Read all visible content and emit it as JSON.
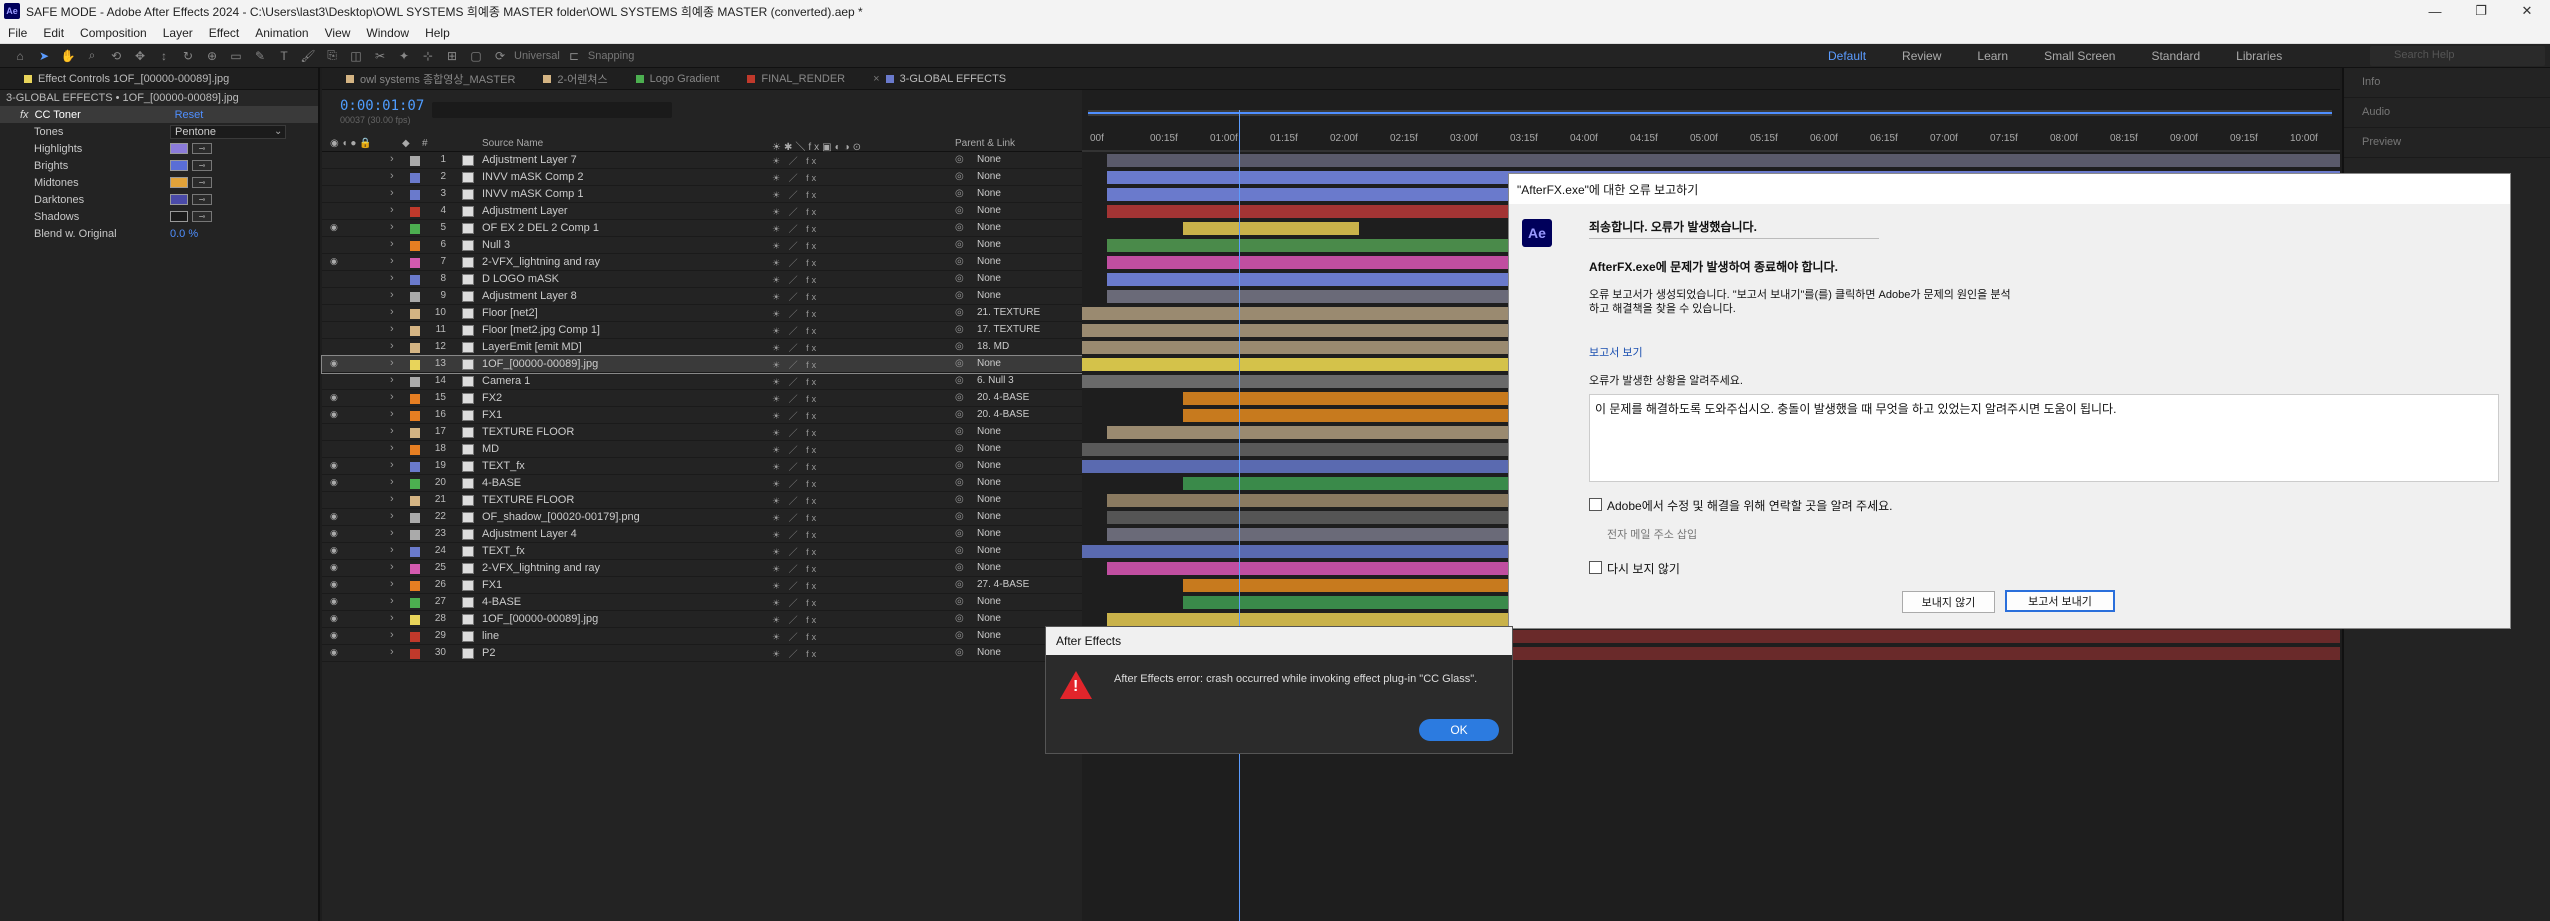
{
  "window": {
    "title": "SAFE MODE - Adobe After Effects 2024 - C:\\Users\\last3\\Desktop\\OWL SYSTEMS 희예종 MASTER folder\\OWL SYSTEMS 희예종 MASTER (converted).aep *",
    "logo": "Ae"
  },
  "menu": [
    "File",
    "Edit",
    "Composition",
    "Layer",
    "Effect",
    "Animation",
    "View",
    "Window",
    "Help"
  ],
  "toolbar": {
    "universal": "Universal",
    "snapping": "Snapping",
    "workspaces": [
      "Default",
      "Review",
      "Learn",
      "Small Screen",
      "Standard",
      "Libraries"
    ],
    "active_workspace": "Default",
    "search_placeholder": "Search Help"
  },
  "effect_controls": {
    "tab": "Effect Controls 1OF_[00000-00089].jpg",
    "subtitle": "3-GLOBAL EFFECTS • 1OF_[00000-00089].jpg",
    "effect_name": "CC Toner",
    "reset": "Reset",
    "props": [
      {
        "label": "Tones",
        "type": "dropdown",
        "value": "Pentone"
      },
      {
        "label": "Highlights",
        "type": "color",
        "color": "#8b7bd9"
      },
      {
        "label": "Brights",
        "type": "color",
        "color": "#5a6ed6"
      },
      {
        "label": "Midtones",
        "type": "color",
        "color": "#e0a23a"
      },
      {
        "label": "Darktones",
        "type": "color",
        "color": "#4a4aa8"
      },
      {
        "label": "Shadows",
        "type": "color",
        "color": "#1a1a1a"
      },
      {
        "label": "Blend w. Original",
        "type": "value",
        "value": "0.0 %"
      }
    ]
  },
  "comp_tabs": [
    "owl systems 종합영상_MASTER",
    "2-어렌쳐스",
    "Logo Gradient",
    "FINAL_RENDER",
    "3-GLOBAL EFFECTS"
  ],
  "timeline": {
    "timecode": "0:00:01:07",
    "fps": "00037 (30.00 fps)",
    "col_source": "Source Name",
    "col_parent": "Parent & Link",
    "ruler": [
      "00f",
      "00:15f",
      "01:00f",
      "01:15f",
      "02:00f",
      "02:15f",
      "03:00f",
      "03:15f",
      "04:00f",
      "04:15f",
      "05:00f",
      "05:15f",
      "06:00f",
      "06:15f",
      "07:00f",
      "07:15f",
      "08:00f",
      "08:15f",
      "09:00f",
      "09:15f",
      "10:00f"
    ],
    "layers": [
      {
        "n": "1",
        "name": "Adjustment Layer 7",
        "color": "#aaaaaa",
        "parent": "None",
        "eye": false,
        "bar": "#5a5a6a",
        "bs": 0.02,
        "be": 1.0
      },
      {
        "n": "2",
        "name": "INVV mASK Comp 2",
        "color": "#6a7acc",
        "parent": "None",
        "eye": false,
        "bar": "#6a7acc",
        "bs": 0.02,
        "be": 1.0
      },
      {
        "n": "3",
        "name": "INVV mASK Comp 1",
        "color": "#6a7acc",
        "parent": "None",
        "eye": false,
        "bar": "#6a7acc",
        "bs": 0.02,
        "be": 1.0
      },
      {
        "n": "4",
        "name": "Adjustment Layer",
        "color": "#c0392b",
        "parent": "None",
        "eye": false,
        "bar": "#a33434",
        "bs": 0.02,
        "be": 1.0
      },
      {
        "n": "5",
        "name": "OF EX 2 DEL 2 Comp 1",
        "color": "#4caf50",
        "parent": "None",
        "eye": true,
        "bar": "#c9b24a",
        "bs": 0.08,
        "be": 0.22
      },
      {
        "n": "6",
        "name": "Null 3",
        "color": "#e67e22",
        "parent": "None",
        "eye": false,
        "bar": "#4a8a4a",
        "bs": 0.02,
        "be": 1.0
      },
      {
        "n": "7",
        "name": "2-VFX_lightning and ray",
        "color": "#d45ab0",
        "parent": "None",
        "eye": true,
        "bar": "#c04ea0",
        "bs": 0.02,
        "be": 1.0
      },
      {
        "n": "8",
        "name": "D LOGO mASK",
        "color": "#6a7acc",
        "parent": "None",
        "eye": false,
        "bar": "#6a7acc",
        "bs": 0.02,
        "be": 1.0
      },
      {
        "n": "9",
        "name": "Adjustment Layer 8",
        "color": "#aaaaaa",
        "parent": "None",
        "eye": false,
        "bar": "#6a6a78",
        "bs": 0.02,
        "be": 1.0
      },
      {
        "n": "10",
        "name": "Floor [net2]",
        "color": "#d4b483",
        "parent": "21. TEXTURE",
        "eye": false,
        "bar": "#9a8a70",
        "bs": 0.0,
        "be": 1.0
      },
      {
        "n": "11",
        "name": "Floor [met2.jpg Comp 1]",
        "color": "#d4b483",
        "parent": "17. TEXTURE",
        "eye": false,
        "bar": "#9a8a70",
        "bs": 0.0,
        "be": 1.0
      },
      {
        "n": "12",
        "name": "LayerEmit [emit MD]",
        "color": "#d4b483",
        "parent": "18. MD",
        "eye": false,
        "bar": "#9a8a70",
        "bs": 0.0,
        "be": 1.0
      },
      {
        "n": "13",
        "name": "1OF_[00000-00089].jpg",
        "color": "#e8d45a",
        "parent": "None",
        "eye": true,
        "sel": true,
        "bar": "#d4c24a",
        "bs": 0.0,
        "be": 1.0
      },
      {
        "n": "14",
        "name": "Camera 1",
        "color": "#aaaaaa",
        "parent": "6. Null 3",
        "eye": false,
        "bar": "#6a6a6a",
        "bs": 0.0,
        "be": 1.0
      },
      {
        "n": "15",
        "name": "FX2",
        "color": "#e67e22",
        "parent": "20. 4-BASE",
        "eye": true,
        "bar": "#c77a1e",
        "bs": 0.08,
        "be": 1.0
      },
      {
        "n": "16",
        "name": "FX1",
        "color": "#e67e22",
        "parent": "20. 4-BASE",
        "eye": true,
        "bar": "#c77a1e",
        "bs": 0.08,
        "be": 1.0
      },
      {
        "n": "17",
        "name": "TEXTURE FLOOR",
        "color": "#d4b483",
        "parent": "None",
        "eye": false,
        "bar": "#9a8a70",
        "bs": 0.02,
        "be": 1.0
      },
      {
        "n": "18",
        "name": "MD",
        "color": "#e67e22",
        "parent": "None",
        "eye": false,
        "bar": "#5a5a5a",
        "bs": 0.0,
        "be": 1.0
      },
      {
        "n": "19",
        "name": "TEXT_fx",
        "color": "#6a7acc",
        "parent": "None",
        "eye": true,
        "bar": "#5a6ab0",
        "bs": 0.0,
        "be": 1.0
      },
      {
        "n": "20",
        "name": "4-BASE",
        "color": "#4caf50",
        "parent": "None",
        "eye": true,
        "bar": "#3a8a4a",
        "bs": 0.08,
        "be": 1.0
      },
      {
        "n": "21",
        "name": "TEXTURE FLOOR",
        "color": "#d4b483",
        "parent": "None",
        "eye": false,
        "bar": "#8a7a60",
        "bs": 0.02,
        "be": 1.0
      },
      {
        "n": "22",
        "name": "OF_shadow_[00020-00179].png",
        "color": "#aaaaaa",
        "parent": "None",
        "eye": true,
        "bar": "#555555",
        "bs": 0.02,
        "be": 1.0
      },
      {
        "n": "23",
        "name": "Adjustment Layer 4",
        "color": "#aaaaaa",
        "parent": "None",
        "eye": true,
        "bar": "#6a6a78",
        "bs": 0.02,
        "be": 1.0
      },
      {
        "n": "24",
        "name": "TEXT_fx",
        "color": "#6a7acc",
        "parent": "None",
        "eye": true,
        "bar": "#5a6ab0",
        "bs": 0.0,
        "be": 1.0
      },
      {
        "n": "25",
        "name": "2-VFX_lightning and ray",
        "color": "#d45ab0",
        "parent": "None",
        "eye": true,
        "bar": "#c04ea0",
        "bs": 0.02,
        "be": 1.0
      },
      {
        "n": "26",
        "name": "FX1",
        "color": "#e67e22",
        "parent": "27. 4-BASE",
        "eye": true,
        "bar": "#c77a1e",
        "bs": 0.08,
        "be": 1.0
      },
      {
        "n": "27",
        "name": "4-BASE",
        "color": "#4caf50",
        "parent": "None",
        "eye": true,
        "bar": "#3a8a4a",
        "bs": 0.08,
        "be": 1.0
      },
      {
        "n": "28",
        "name": "1OF_[00000-00089].jpg",
        "color": "#e8d45a",
        "parent": "None",
        "eye": true,
        "bar": "#c9b24a",
        "bs": 0.02,
        "be": 1.0
      },
      {
        "n": "29",
        "name": "line",
        "color": "#c0392b",
        "parent": "None",
        "eye": true,
        "bar": "#6a2a2a",
        "bs": 0.02,
        "be": 1.0
      },
      {
        "n": "30",
        "name": "P2",
        "color": "#c0392b",
        "parent": "None",
        "eye": true,
        "bar": "#6a2a2a",
        "bs": 0.0,
        "be": 1.0
      }
    ]
  },
  "right_panel": [
    "Info",
    "Audio",
    "Preview"
  ],
  "crash_dialog": {
    "title": "\"AfterFX.exe\"에 대한 오류 보고하기",
    "heading": "죄송합니다. 오류가 발생했습니다.",
    "subheading": "AfterFX.exe에 문제가 발생하여 종료해야 합니다.",
    "body1": "오류 보고서가 생성되었습니다. \"보고서 보내기\"를(를) 클릭하면 Adobe가 문제의 원인을 분석",
    "body2": "하고 해결책을 찾을 수 있습니다.",
    "view_report": "보고서 보기",
    "tell_us": "오류가 발생한 상황을 알려주세요.",
    "textarea": "이 문제를 해결하도록 도와주십시오. 충돌이 발생했을 때 무엇을 하고 있었는지 알려주시면 도움이 됩니다.",
    "contact_cb": "Adobe에서 수정 및 해결을 위해 연락할 곳을 알려 주세요.",
    "email_placeholder": "전자 메일 주소 삽입",
    "dont_show_cb": "다시 보지 않기",
    "dont_send": "보내지 않기",
    "send": "보고서 보내기"
  },
  "ae_alert": {
    "title": "After Effects",
    "message": "After Effects error: crash occurred while invoking effect plug-in \"CC Glass\".",
    "ok": "OK"
  }
}
